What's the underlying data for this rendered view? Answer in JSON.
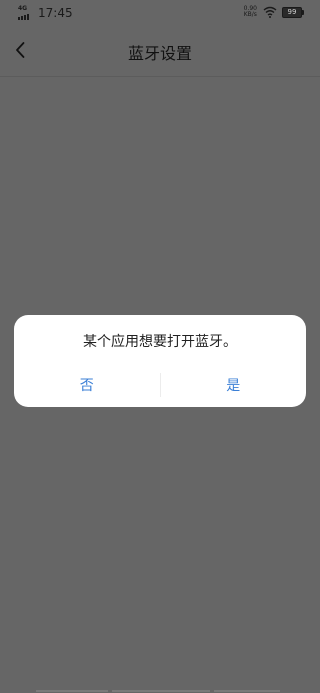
{
  "status_bar": {
    "network_type": "4G",
    "time": "17:45",
    "net_speed_value": "0.90",
    "net_speed_unit": "KB/s",
    "battery_level": "99",
    "signal_icon": "signal-bars-icon",
    "wifi_icon": "wifi-icon",
    "battery_icon": "battery-icon"
  },
  "header": {
    "title": "蓝牙设置",
    "back_icon": "chevron-left-icon"
  },
  "dialog": {
    "message": "某个应用想要打开蓝牙。",
    "deny_label": "否",
    "allow_label": "是"
  },
  "colors": {
    "overlay": "#666666",
    "dialog_background": "#ffffff",
    "button_text": "#3b7fd6"
  }
}
